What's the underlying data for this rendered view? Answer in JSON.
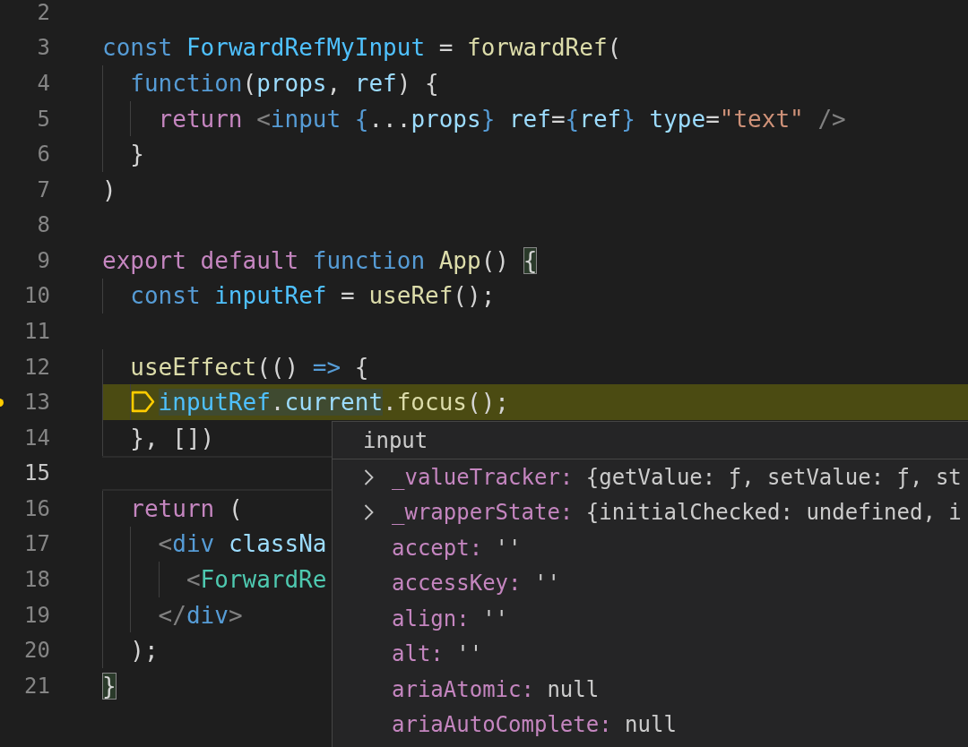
{
  "editor": {
    "lines": [
      {
        "number": "2"
      },
      {
        "number": "3",
        "tokens": [
          {
            "text": "const ",
            "kind": "kw"
          },
          {
            "text": "ForwardRefMyInput",
            "kind": "ident"
          },
          {
            "text": " = ",
            "kind": "punc"
          },
          {
            "text": "forwardRef",
            "kind": "fn"
          },
          {
            "text": "(",
            "kind": "punc"
          }
        ]
      },
      {
        "number": "4",
        "tokens": [
          {
            "text": "  function",
            "kind": "kw"
          },
          {
            "text": "(",
            "kind": "punc"
          },
          {
            "text": "props",
            "kind": "var"
          },
          {
            "text": ", ",
            "kind": "punc"
          },
          {
            "text": "ref",
            "kind": "var"
          },
          {
            "text": ") {",
            "kind": "punc"
          }
        ]
      },
      {
        "number": "5",
        "tokens": [
          {
            "text": "    return ",
            "kind": "ctrl"
          },
          {
            "text": "<",
            "kind": "tagp"
          },
          {
            "text": "input ",
            "kind": "tag"
          },
          {
            "text": "{",
            "kind": "brace"
          },
          {
            "text": "...",
            "kind": "punc"
          },
          {
            "text": "props",
            "kind": "var"
          },
          {
            "text": "} ",
            "kind": "brace"
          },
          {
            "text": "ref",
            "kind": "attr"
          },
          {
            "text": "=",
            "kind": "punc"
          },
          {
            "text": "{",
            "kind": "brace"
          },
          {
            "text": "ref",
            "kind": "var"
          },
          {
            "text": "} ",
            "kind": "brace"
          },
          {
            "text": "type",
            "kind": "attr"
          },
          {
            "text": "=",
            "kind": "punc"
          },
          {
            "text": "\"text\" ",
            "kind": "str"
          },
          {
            "text": "/>",
            "kind": "tagp"
          }
        ]
      },
      {
        "number": "6",
        "tokens": [
          {
            "text": "  }",
            "kind": "punc"
          }
        ]
      },
      {
        "number": "7",
        "tokens": [
          {
            "text": ")",
            "kind": "punc"
          }
        ]
      },
      {
        "number": "8"
      },
      {
        "number": "9",
        "tokens": [
          {
            "text": "export ",
            "kind": "ctrl"
          },
          {
            "text": "default ",
            "kind": "ctrl"
          },
          {
            "text": "function ",
            "kind": "kw"
          },
          {
            "text": "App",
            "kind": "fn"
          },
          {
            "text": "() ",
            "kind": "punc"
          },
          {
            "text": "{",
            "kind": "punc",
            "match": true
          }
        ]
      },
      {
        "number": "10",
        "tokens": [
          {
            "text": "  const ",
            "kind": "kw"
          },
          {
            "text": "inputRef",
            "kind": "ident"
          },
          {
            "text": " = ",
            "kind": "punc"
          },
          {
            "text": "useRef",
            "kind": "fn"
          },
          {
            "text": "();",
            "kind": "punc"
          }
        ]
      },
      {
        "number": "11"
      },
      {
        "number": "12",
        "tokens": [
          {
            "text": "  useEffect",
            "kind": "fn"
          },
          {
            "text": "(() ",
            "kind": "punc"
          },
          {
            "text": "=>",
            "kind": "kw"
          },
          {
            "text": " {",
            "kind": "punc"
          }
        ]
      },
      {
        "number": "13",
        "paused": true,
        "tokens": [
          {
            "text": "    inputRef",
            "kind": "ident",
            "hl": true
          },
          {
            "text": ".",
            "kind": "punc",
            "hl": true
          },
          {
            "text": "current",
            "kind": "var",
            "hl": true
          },
          {
            "text": ".",
            "kind": "punc"
          },
          {
            "text": "focus",
            "kind": "fn"
          },
          {
            "text": "();",
            "kind": "punc"
          }
        ]
      },
      {
        "number": "14",
        "tokens": [
          {
            "text": "  }, [])",
            "kind": "punc"
          }
        ]
      },
      {
        "number": "15",
        "current": true
      },
      {
        "number": "16",
        "tokens": [
          {
            "text": "  return ",
            "kind": "ctrl"
          },
          {
            "text": "(",
            "kind": "punc"
          }
        ]
      },
      {
        "number": "17",
        "tokens": [
          {
            "text": "    <",
            "kind": "tagp"
          },
          {
            "text": "div ",
            "kind": "tag"
          },
          {
            "text": "classNa",
            "kind": "attr"
          }
        ]
      },
      {
        "number": "18",
        "tokens": [
          {
            "text": "      <",
            "kind": "tagp"
          },
          {
            "text": "ForwardRe",
            "kind": "comp"
          }
        ]
      },
      {
        "number": "19",
        "tokens": [
          {
            "text": "    </",
            "kind": "tagp"
          },
          {
            "text": "div",
            "kind": "tag"
          },
          {
            "text": ">",
            "kind": "tagp"
          }
        ]
      },
      {
        "number": "20",
        "tokens": [
          {
            "text": "  );",
            "kind": "punc"
          }
        ]
      },
      {
        "number": "21",
        "tokens": [
          {
            "text": "}",
            "kind": "punc",
            "match": true
          }
        ]
      }
    ]
  },
  "hover": {
    "title": "input",
    "items": [
      {
        "key": "_valueTracker:",
        "value": "{getValue: ƒ, setValue: ƒ, st",
        "kind": "object"
      },
      {
        "key": "_wrapperState:",
        "value": "{initialChecked: undefined, i",
        "kind": "object"
      },
      {
        "key": "accept:",
        "value": "''",
        "kind": "string"
      },
      {
        "key": "accessKey:",
        "value": "''",
        "kind": "string"
      },
      {
        "key": "align:",
        "value": "''",
        "kind": "string"
      },
      {
        "key": "alt:",
        "value": "''",
        "kind": "string"
      },
      {
        "key": "ariaAtomic:",
        "value": "null",
        "kind": "null"
      },
      {
        "key": "ariaAutoComplete:",
        "value": "null",
        "kind": "null"
      }
    ]
  }
}
